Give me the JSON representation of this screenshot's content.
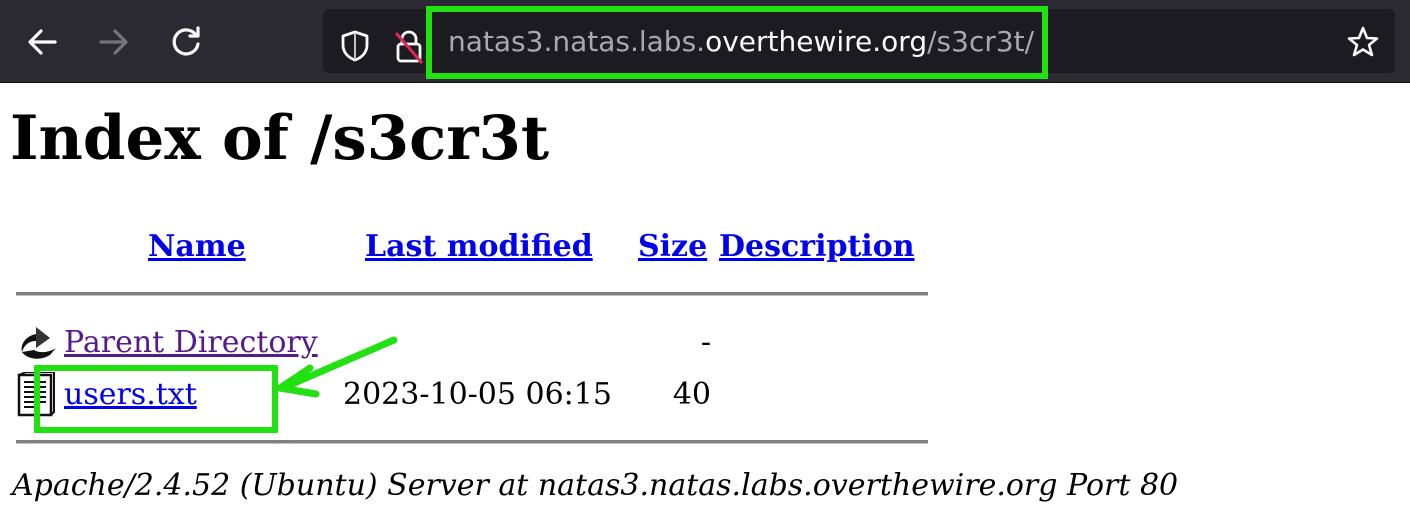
{
  "browser": {
    "url_scheme_host_prefix": "natas3.natas.labs.",
    "url_domain": "overthewire.org",
    "url_path": "/s3cr3t/",
    "icons": {
      "back": "arrow-left-icon",
      "forward": "arrow-right-icon",
      "reload": "reload-icon",
      "shield": "shield-icon",
      "insecure_lock": "insecure-lock-icon",
      "bookmark": "star-icon"
    }
  },
  "page": {
    "title": "Index of /s3cr3t",
    "columns": {
      "name": "Name",
      "last_modified": "Last modified",
      "size": "Size",
      "description": "Description"
    },
    "rows": [
      {
        "icon": "back-folder-icon",
        "name": "Parent Directory",
        "modified": "",
        "size": "-",
        "description": ""
      },
      {
        "icon": "text-file-icon",
        "name": "users.txt",
        "modified": "2023-10-05 06:15",
        "size": "40",
        "description": ""
      }
    ],
    "footer": "Apache/2.4.52 (Ubuntu) Server at natas3.natas.labs.overthewire.org Port 80"
  },
  "annotation": {
    "color": "#22e012"
  }
}
